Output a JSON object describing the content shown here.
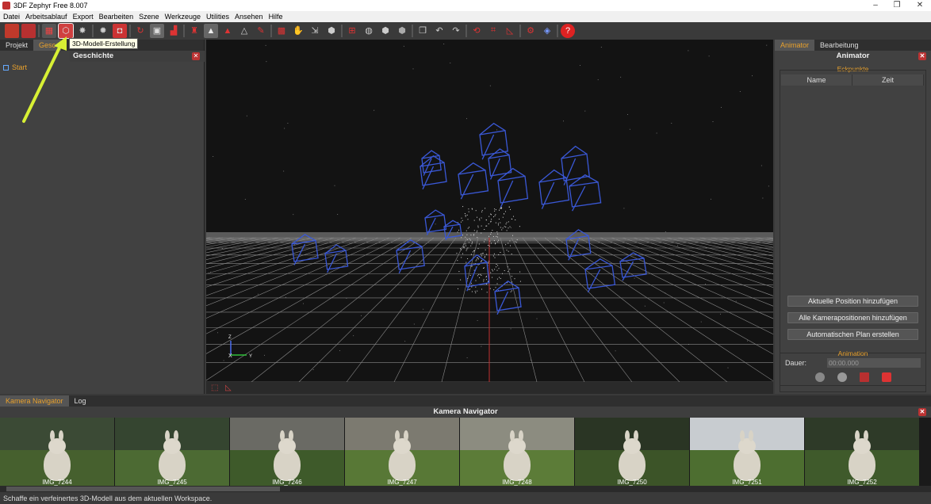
{
  "window": {
    "title": "3DF Zephyr Free 8.007"
  },
  "menu": [
    "Datei",
    "Arbeitsablauf",
    "Export",
    "Bearbeiten",
    "Szene",
    "Werkzeuge",
    "Utilities",
    "Ansehen",
    "Hilfe"
  ],
  "toolbar": {
    "tooltip": "3D-Modell-Erstellung",
    "icons": [
      "new-project-icon",
      "save-icon",
      "sparse-icon",
      "dense-model-icon",
      "mesh-icon",
      "texture-icon",
      "camera-icon",
      "refresh-icon",
      "select-icon",
      "measure-icon",
      "pin-icon",
      "mesh-filled-icon",
      "mesh-red-icon",
      "mesh-outline-icon",
      "brush-icon",
      "filter-icon",
      "hand-icon",
      "move-icon",
      "shapes-icon",
      "grid-icon",
      "sphere-icon",
      "shield-icon",
      "shield-dark-icon",
      "copy-icon",
      "undo-icon",
      "redo-icon",
      "orbit-icon",
      "crop-icon",
      "ruler-icon",
      "settings-icon",
      "cube-icon",
      "help-icon"
    ]
  },
  "left_panel": {
    "tabs": [
      "Projekt",
      "Geschichte"
    ],
    "active_tab_visible": "Gesc",
    "title": "Geschichte",
    "start_item": "Start"
  },
  "right_panel": {
    "tabs": [
      "Animator",
      "Bearbeitung"
    ],
    "title": "Animator",
    "keypoints_label": "Eckpunkte",
    "columns": [
      "Name",
      "Zeit"
    ],
    "buttons": [
      "Aktuelle Position hinzufügen",
      "Alle Kamerapositionen hinzufügen",
      "Automatischen Plan erstellen"
    ],
    "animation_label": "Animation",
    "duration_label": "Dauer:",
    "duration_value": "00:00.000"
  },
  "axes": {
    "z": "Z",
    "x": "X",
    "y": "Y"
  },
  "bottom": {
    "tabs": [
      "Kamera Navigator",
      "Log"
    ],
    "title": "Kamera Navigator",
    "thumbnails": [
      "IMG_7244",
      "IMG_7245",
      "IMG_7246",
      "IMG_7247",
      "IMG_7248",
      "IMG_7250",
      "IMG_7251",
      "IMG_7252"
    ]
  },
  "status": "Schaffe ein verfeinertes 3D-Modell aus dem aktuellen Workspace.",
  "colors": {
    "accent": "#e9a12c",
    "arrow": "#d8f034",
    "camera": "#3a58d6",
    "active_tool": "#d04040"
  }
}
